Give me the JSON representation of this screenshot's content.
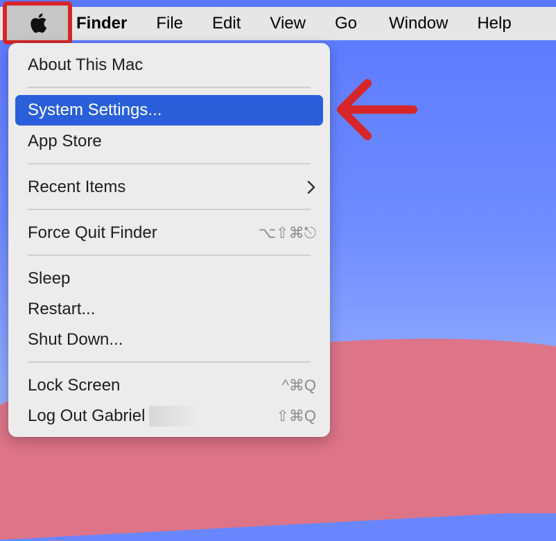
{
  "menubar": {
    "apple_icon": "apple-logo-icon",
    "items": [
      "Finder",
      "File",
      "Edit",
      "View",
      "Go",
      "Window",
      "Help"
    ]
  },
  "apple_menu": {
    "about": "About This Mac",
    "system_settings": "System Settings...",
    "app_store": "App Store",
    "recent_items": "Recent Items",
    "force_quit": "Force Quit Finder",
    "force_quit_shortcut": "⌥⇧⌘⎋",
    "sleep": "Sleep",
    "restart": "Restart...",
    "shut_down": "Shut Down...",
    "lock_screen": "Lock Screen",
    "lock_screen_shortcut": "^⌘Q",
    "log_out": "Log Out Gabriel",
    "log_out_shortcut": "⇧⌘Q"
  },
  "colors": {
    "highlight": "#2a5fd9",
    "annotation_red": "#d6262a"
  }
}
